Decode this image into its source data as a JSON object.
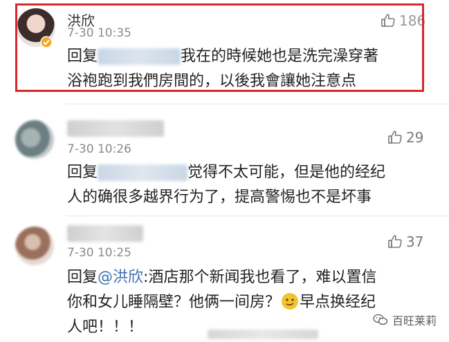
{
  "comments": [
    {
      "username": "洪欣",
      "time": "7-30 10:35",
      "likes": "186",
      "reply_prefix": "回复",
      "text_line1": "我在的時候她也是洗完澡穿著",
      "text_line2": "浴袍跑到我們房間的，以後我會讓她注意点",
      "verified": true
    },
    {
      "username": "",
      "time": "7-30 10:26",
      "likes": "29",
      "reply_prefix": "回复",
      "text_line1": "觉得不太可能，但是他的经纪",
      "text_line2": "人的确很多越界行为了，提高警惕也不是坏事"
    },
    {
      "username": "",
      "time": "7-30 10:25",
      "likes": "37",
      "reply_prefix": "回复",
      "mention": "@洪欣",
      "text_line1": ":酒店那个新闻我也看了，难以置信",
      "text_line2_a": "你和女儿睡隔壁？他俩一间房？",
      "text_line2_b": "早点换经纪",
      "text_line3": "人吧！！！"
    }
  ],
  "watermark": {
    "label": "百旺莱莉"
  },
  "colors": {
    "highlight": "#d8262b",
    "mention": "#3b6fb6",
    "verified": "#f5a623"
  },
  "icons": {
    "like": "thumbs-up-icon",
    "verified": "verified-badge-icon",
    "emoji": "smirk-emoji-icon",
    "watermark": "wechat-icon"
  }
}
